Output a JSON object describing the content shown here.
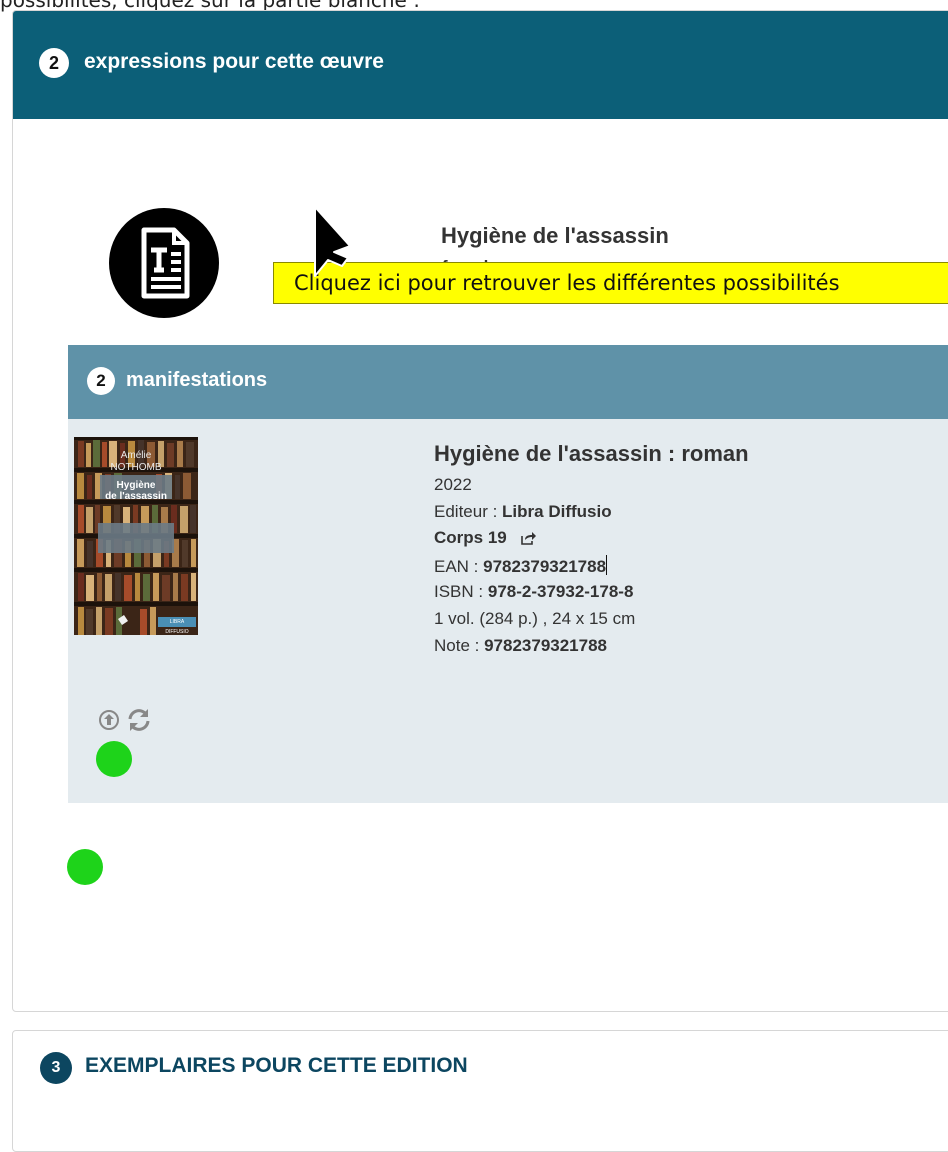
{
  "top_text": "possibilités, cliquez sur la partie blanche :",
  "expressions": {
    "count": "2",
    "title": "expressions pour cette œuvre",
    "work_title": "Hygiène de l'assassin",
    "language": "french",
    "icon": "text-document-icon"
  },
  "tooltip": {
    "text": "Cliquez ici pour retrouver les différentes possibilités"
  },
  "manifestations": {
    "count": "2",
    "title": "manifestations",
    "item": {
      "title": "Hygiène de l'assassin : roman",
      "year": "2022",
      "publisher_label": "Editeur : ",
      "publisher": "Libra Diffusio",
      "collection": "Corps 19",
      "ean_label": "EAN : ",
      "ean": "9782379321788",
      "isbn_label": "ISBN : ",
      "isbn": "978-2-37932-178-8",
      "extent": "1 vol. (284 p.) , 24 x 15 cm",
      "note_label": "Note : ",
      "note": "9782379321788",
      "cover": {
        "author_first": "Amélie",
        "author_last": "NOTHOMB",
        "title_line1": "Hygiène",
        "title_line2": "de l'assassin",
        "footer": "LIBRA DIFFUSIO"
      }
    }
  },
  "exemplaires": {
    "count": "3",
    "title": "EXEMPLAIRES POUR CETTE EDITION"
  },
  "colors": {
    "header_dark": "#0c5f78",
    "header_manif": "#5f92a8",
    "manif_bg": "#e4ebef",
    "tooltip_bg": "#ffff00",
    "status_green": "#1ed31a",
    "exemplaires_accent": "#0c4660"
  }
}
